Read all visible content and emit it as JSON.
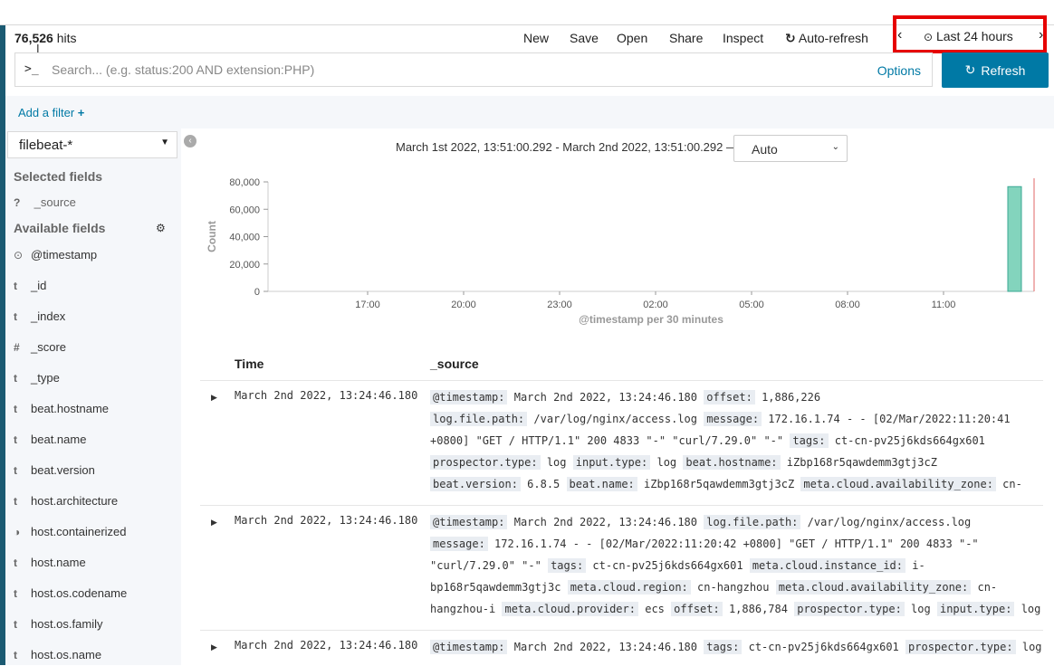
{
  "header": {
    "hits_count": "76,526",
    "hits_label": "hits",
    "menu": [
      "New",
      "Save",
      "Open",
      "Share",
      "Inspect"
    ],
    "autorefresh_label": "Auto-refresh",
    "time_label": "Last 24 hours"
  },
  "search": {
    "prompt": ">_",
    "placeholder": "Search... (e.g. status:200 AND extension:PHP)",
    "options_label": "Options",
    "refresh_label": "Refresh"
  },
  "filter": {
    "add_label": "Add a filter"
  },
  "sidebar": {
    "index_pattern": "filebeat-*",
    "selected_title": "Selected fields",
    "selected_fields": [
      {
        "type": "?",
        "name": "_source"
      }
    ],
    "available_title": "Available fields",
    "available_fields": [
      {
        "type": "clock",
        "name": "@timestamp"
      },
      {
        "type": "t",
        "name": "_id"
      },
      {
        "type": "t",
        "name": "_index"
      },
      {
        "type": "#",
        "name": "_score"
      },
      {
        "type": "t",
        "name": "_type"
      },
      {
        "type": "t",
        "name": "beat.hostname"
      },
      {
        "type": "t",
        "name": "beat.name"
      },
      {
        "type": "t",
        "name": "beat.version"
      },
      {
        "type": "t",
        "name": "host.architecture"
      },
      {
        "type": "bool",
        "name": "host.containerized"
      },
      {
        "type": "t",
        "name": "host.name"
      },
      {
        "type": "t",
        "name": "host.os.codename"
      },
      {
        "type": "t",
        "name": "host.os.family"
      },
      {
        "type": "t",
        "name": "host.os.name"
      }
    ]
  },
  "histogram": {
    "range_text": "March 1st 2022, 13:51:00.292 - March 2nd 2022, 13:51:00.292 —",
    "interval": "Auto"
  },
  "chart_data": {
    "type": "bar",
    "ylabel": "Count",
    "xlabel": "@timestamp per 30 minutes",
    "ylim": [
      0,
      80000
    ],
    "yticks": [
      "80,000",
      "60,000",
      "40,000",
      "20,000",
      "0"
    ],
    "xticks": [
      "17:00",
      "20:00",
      "23:00",
      "02:00",
      "05:00",
      "08:00",
      "11:00"
    ],
    "categories": [
      "13:00"
    ],
    "values": [
      76526
    ],
    "bar_color": "#6dccb1"
  },
  "table": {
    "col_time": "Time",
    "col_source": "_source",
    "rows": [
      {
        "time": "March 2nd 2022, 13:24:46.180",
        "lines": [
          [
            [
              "@timestamp:",
              "March 2nd 2022, 13:24:46.180"
            ],
            [
              "offset:",
              "1,886,226"
            ]
          ],
          [
            [
              "log.file.path:",
              "/var/log/nginx/access.log"
            ],
            [
              "message:",
              "172.16.1.74 - - [02/Mar/2022:11:20:41"
            ]
          ],
          [
            [
              "",
              "+0800] \"GET / HTTP/1.1\" 200 4833 \"-\" \"curl/7.29.0\" \"-\""
            ],
            [
              "tags:",
              "ct-cn-pv25j6kds664gx601"
            ]
          ],
          [
            [
              "prospector.type:",
              "log"
            ],
            [
              "input.type:",
              "log"
            ],
            [
              "beat.hostname:",
              "iZbp168r5qawdemm3gtj3cZ"
            ]
          ],
          [
            [
              "beat.version:",
              "6.8.5"
            ],
            [
              "beat.name:",
              "iZbp168r5qawdemm3gtj3cZ"
            ],
            [
              "meta.cloud.availability_zone:",
              "cn-"
            ]
          ]
        ]
      },
      {
        "time": "March 2nd 2022, 13:24:46.180",
        "lines": [
          [
            [
              "@timestamp:",
              "March 2nd 2022, 13:24:46.180"
            ],
            [
              "log.file.path:",
              "/var/log/nginx/access.log"
            ]
          ],
          [
            [
              "message:",
              "172.16.1.74 - - [02/Mar/2022:11:20:42 +0800] \"GET / HTTP/1.1\" 200 4833 \"-\""
            ]
          ],
          [
            [
              "",
              "\"curl/7.29.0\" \"-\""
            ],
            [
              "tags:",
              "ct-cn-pv25j6kds664gx601"
            ],
            [
              "meta.cloud.instance_id:",
              "i-"
            ]
          ],
          [
            [
              "",
              "bp168r5qawdemm3gtj3c"
            ],
            [
              "meta.cloud.region:",
              "cn-hangzhou"
            ],
            [
              "meta.cloud.availability_zone:",
              "cn-"
            ]
          ],
          [
            [
              "",
              "hangzhou-i"
            ],
            [
              "meta.cloud.provider:",
              "ecs"
            ],
            [
              "offset:",
              "1,886,784"
            ],
            [
              "prospector.type:",
              "log"
            ],
            [
              "input.type:",
              "log"
            ]
          ]
        ]
      },
      {
        "time": "March 2nd 2022, 13:24:46.180",
        "lines": [
          [
            [
              "@timestamp:",
              "March 2nd 2022, 13:24:46.180"
            ],
            [
              "tags:",
              "ct-cn-pv25j6kds664gx601"
            ],
            [
              "prospector.type:",
              "log"
            ]
          ]
        ]
      }
    ]
  }
}
